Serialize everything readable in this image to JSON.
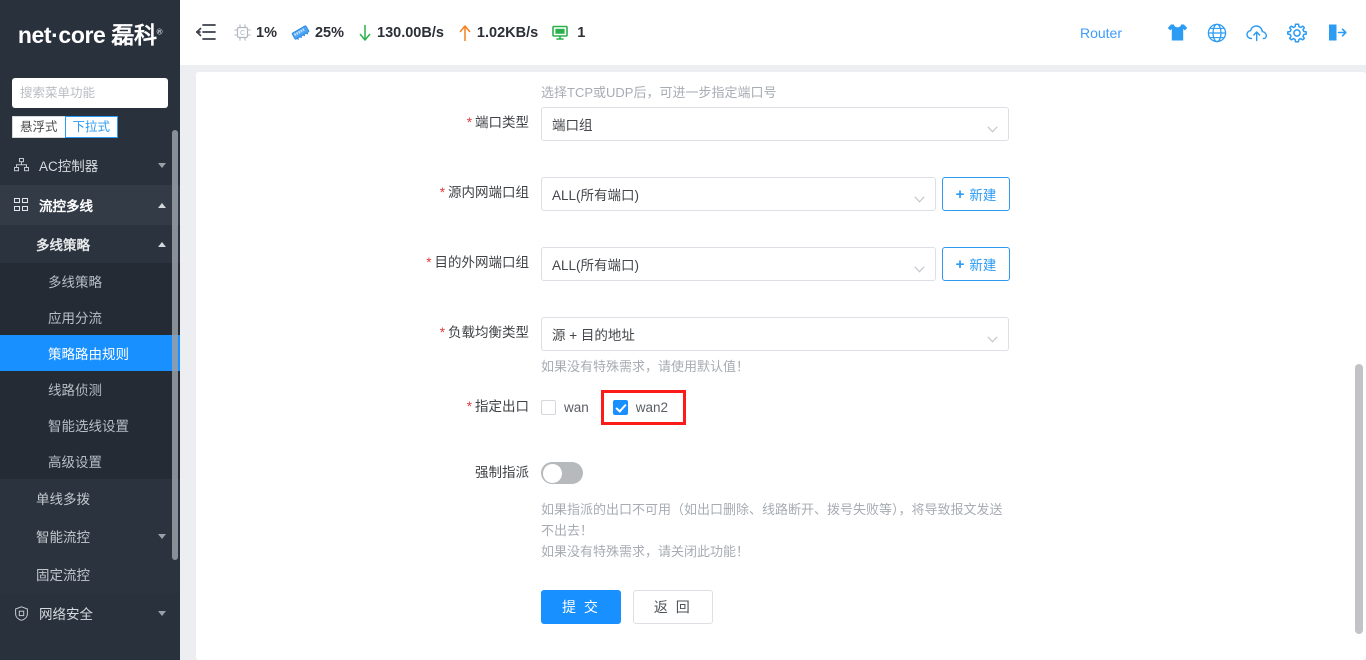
{
  "sidebar": {
    "brand": "net·core 磊科",
    "brand_reg": "®",
    "search_placeholder": "搜索菜单功能",
    "mode_tabs": [
      {
        "label": "悬浮式",
        "active": false
      },
      {
        "label": "下拉式",
        "active": true
      }
    ],
    "menu": [
      {
        "label": "AC控制器",
        "icon": "sitemap-icon",
        "expanded": false
      },
      {
        "label": "流控多线",
        "icon": "grid-icon",
        "expanded": true
      }
    ],
    "group": {
      "label": "多线策略",
      "expanded": true
    },
    "items": [
      {
        "label": "多线策略",
        "active": false
      },
      {
        "label": "应用分流",
        "active": false
      },
      {
        "label": "策略路由规则",
        "active": true
      },
      {
        "label": "线路侦测",
        "active": false
      },
      {
        "label": "智能选线设置",
        "active": false
      },
      {
        "label": "高级设置",
        "active": false
      }
    ],
    "tail_items": [
      {
        "label": "单线多拨",
        "caret": false
      },
      {
        "label": "智能流控",
        "caret": true
      },
      {
        "label": "固定流控",
        "caret": false
      }
    ],
    "bottom_menu": [
      {
        "label": "网络安全",
        "icon": "shield-icon",
        "expanded": false
      }
    ]
  },
  "topbar": {
    "collapse_icon": "collapse-menu-icon",
    "stats": [
      {
        "icon": "cpu-icon",
        "value": "1%"
      },
      {
        "icon": "memory-icon",
        "value": "25%"
      },
      {
        "icon": "download-arrow-icon",
        "value": "130.00B/s"
      },
      {
        "icon": "upload-arrow-icon",
        "value": "1.02KB/s"
      },
      {
        "icon": "monitor-icon",
        "value": "1"
      }
    ],
    "router_label": "Router",
    "icons": [
      "tshirt-icon",
      "globe-icon",
      "cloud-upload-icon",
      "gear-icon",
      "logout-icon"
    ],
    "accent": "#3e9bfb"
  },
  "form": {
    "top_hint": "选择TCP或UDP后，可进一步指定端口号",
    "rows": {
      "port_type": {
        "label": "端口类型",
        "required": true,
        "value": "端口组"
      },
      "src_lan_portgroup": {
        "label": "源内网端口组",
        "required": true,
        "value": "ALL(所有端口)",
        "new_btn": "新建"
      },
      "dst_wan_portgroup": {
        "label": "目的外网端口组",
        "required": true,
        "value": "ALL(所有端口)",
        "new_btn": "新建"
      },
      "lb_type": {
        "label": "负载均衡类型",
        "required": true,
        "value": "源 + 目的地址",
        "hint": "如果没有特殊需求，请使用默认值！"
      },
      "egress": {
        "label": "指定出口",
        "required": true,
        "options": [
          {
            "label": "wan",
            "checked": false,
            "highlighted": false
          },
          {
            "label": "wan2",
            "checked": true,
            "highlighted": true
          }
        ],
        "highlight_color": "#fc1b1b"
      },
      "force_assign": {
        "label": "强制指派",
        "required": false,
        "enabled": false,
        "notes_line1": "如果指派的出口不可用（如出口删除、线路断开、拨号失败等），将导致报文发送不出去！",
        "notes_line2": "如果没有特殊需求，请关闭此功能！"
      }
    },
    "buttons": {
      "submit": "提 交",
      "back": "返 回"
    }
  }
}
